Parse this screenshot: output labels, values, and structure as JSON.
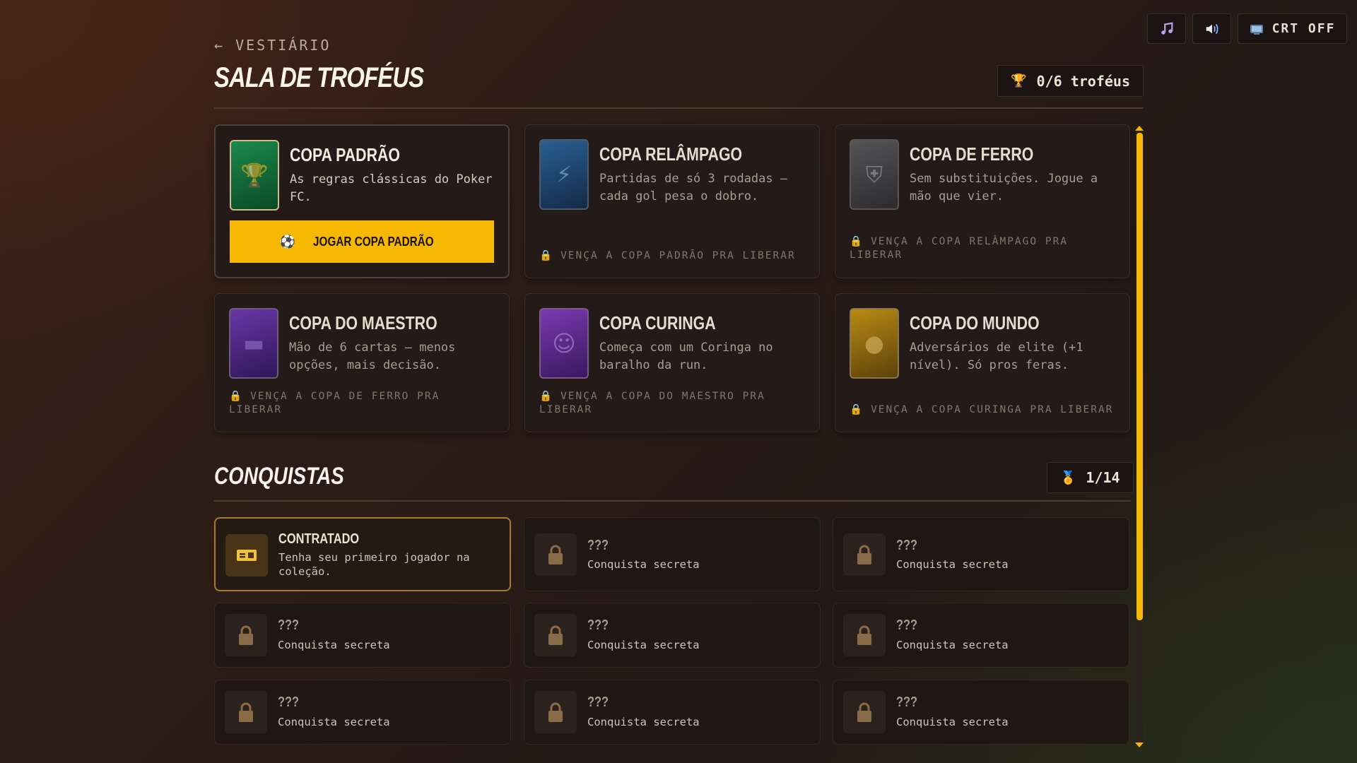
{
  "topbar": {
    "music_icon": "music-note-icon",
    "sound_icon": "speaker-icon",
    "crt_icon": "tv-icon",
    "crt_label": "CRT OFF"
  },
  "header": {
    "back_label": "← VESTIÁRIO",
    "title": "SALA DE TROFÉUS",
    "trophy_icon": "🏆",
    "trophy_count": "0/6 troféus"
  },
  "cups": [
    {
      "name": "COPA PADRÃO",
      "desc": "As regras clássicas do Poker FC.",
      "status": "unlocked",
      "button": "JOGAR COPA PADRÃO",
      "button_icon": "⚽",
      "color": "#0f6a3a",
      "icon": "trophy-icon"
    },
    {
      "name": "COPA RELÂMPAGO",
      "desc": "Partidas de só 3 rodadas — cada gol pesa o dobro.",
      "status": "locked",
      "lock_text": "VENÇA A COPA PADRÃO PRA LIBERAR",
      "color": "#1d4f7e",
      "icon": "lightning-icon"
    },
    {
      "name": "COPA DE FERRO",
      "desc": "Sem substituições. Jogue a mão que vier.",
      "status": "locked",
      "lock_text": "VENÇA A COPA RELÂMPAGO PRA LIBERAR",
      "color": "#4a4a4e",
      "icon": "shield-icon"
    },
    {
      "name": "COPA DO MAESTRO",
      "desc": "Mão de 6 cartas — menos opções, mais decisão.",
      "status": "locked",
      "lock_text": "VENÇA A COPA DE FERRO PRA LIBERAR",
      "color": "#5a2d8e",
      "icon": "cards-icon"
    },
    {
      "name": "COPA CURINGA",
      "desc": "Começa com um Coringa no baralho da run.",
      "status": "locked",
      "lock_text": "VENÇA A COPA DO MAESTRO PRA LIBERAR",
      "color": "#6b2f9a",
      "icon": "joker-icon"
    },
    {
      "name": "COPA DO MUNDO",
      "desc": "Adversários de elite (+1 nível). Só pros feras.",
      "status": "locked",
      "lock_text": "VENÇA A COPA CURINGA PRA LIBERAR",
      "color": "#a27a12",
      "icon": "globe-icon"
    }
  ],
  "achievements_section": {
    "title": "CONQUISTAS",
    "medal_icon": "🏅",
    "count": "1/14"
  },
  "achievements": [
    {
      "name": "CONTRATADO",
      "desc": "Tenha seu primeiro jogador na coleção.",
      "status": "unlocked",
      "icon": "ticket-icon"
    },
    {
      "name": "???",
      "desc": "Conquista secreta",
      "status": "locked",
      "icon": "lock-icon"
    },
    {
      "name": "???",
      "desc": "Conquista secreta",
      "status": "locked",
      "icon": "lock-icon"
    },
    {
      "name": "???",
      "desc": "Conquista secreta",
      "status": "locked",
      "icon": "lock-icon"
    },
    {
      "name": "???",
      "desc": "Conquista secreta",
      "status": "locked",
      "icon": "lock-icon"
    },
    {
      "name": "???",
      "desc": "Conquista secreta",
      "status": "locked",
      "icon": "lock-icon"
    },
    {
      "name": "???",
      "desc": "Conquista secreta",
      "status": "locked",
      "icon": "lock-icon"
    },
    {
      "name": "???",
      "desc": "Conquista secreta",
      "status": "locked",
      "icon": "lock-icon"
    },
    {
      "name": "???",
      "desc": "Conquista secreta",
      "status": "locked",
      "icon": "lock-icon"
    }
  ],
  "colors": {
    "accent": "#f6b800",
    "panel": "#241a17",
    "lock": "#8a6b48"
  }
}
